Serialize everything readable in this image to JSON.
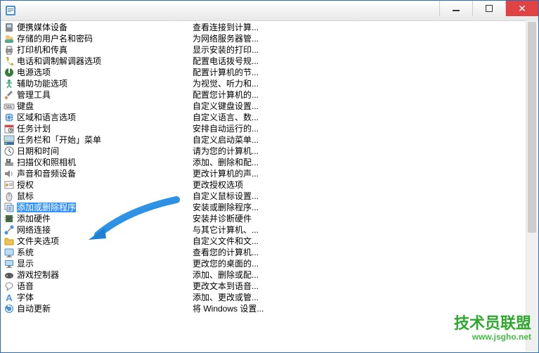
{
  "window": {
    "title": ""
  },
  "items": [
    {
      "icon": "device-icon",
      "name": "便携媒体设备",
      "desc": "查看连接到计算..."
    },
    {
      "icon": "users-icon",
      "name": "存储的用户名和密码",
      "desc": "为网络服务器管..."
    },
    {
      "icon": "printer-icon",
      "name": "打印机和传真",
      "desc": "显示安装的打印..."
    },
    {
      "icon": "phone-icon",
      "name": "电话和调制解调器选项",
      "desc": "配置电话拨号规..."
    },
    {
      "icon": "power-icon",
      "name": "电源选项",
      "desc": "配置计算机的节..."
    },
    {
      "icon": "accessibility-icon",
      "name": "辅助功能选项",
      "desc": "为视觉、听力和..."
    },
    {
      "icon": "tools-icon",
      "name": "管理工具",
      "desc": "配置您计算机的..."
    },
    {
      "icon": "keyboard-icon",
      "name": "键盘",
      "desc": "自定义键盘设置..."
    },
    {
      "icon": "globe-icon",
      "name": "区域和语言选项",
      "desc": "自定义语言、数..."
    },
    {
      "icon": "schedule-icon",
      "name": "任务计划",
      "desc": "安排自动运行的..."
    },
    {
      "icon": "taskbar-icon",
      "name": "任务栏和「开始」菜单",
      "desc": "自定义启动菜单..."
    },
    {
      "icon": "clock-icon",
      "name": "日期和时间",
      "desc": "请为您的计算机..."
    },
    {
      "icon": "scanner-icon",
      "name": "扫描仪和照相机",
      "desc": "添加、删除和配..."
    },
    {
      "icon": "sound-icon",
      "name": "声音和音频设备",
      "desc": "更改计算机的声..."
    },
    {
      "icon": "license-icon",
      "name": "授权",
      "desc": "更改授权选项"
    },
    {
      "icon": "mouse-icon",
      "name": "鼠标",
      "desc": "自定义鼠标设置..."
    },
    {
      "icon": "add-remove-programs-icon",
      "name": "添加或删除程序",
      "desc": "安装或删除程序...",
      "selected": true
    },
    {
      "icon": "hardware-icon",
      "name": "添加硬件",
      "desc": "安装并诊断硬件"
    },
    {
      "icon": "network-icon",
      "name": "网络连接",
      "desc": "与其它计算机、..."
    },
    {
      "icon": "folder-icon",
      "name": "文件夹选项",
      "desc": "自定义文件和文..."
    },
    {
      "icon": "system-icon",
      "name": "系统",
      "desc": "查看您的计算机..."
    },
    {
      "icon": "display-icon",
      "name": "显示",
      "desc": "更改您的桌面的..."
    },
    {
      "icon": "game-icon",
      "name": "游戏控制器",
      "desc": "添加、删除或配..."
    },
    {
      "icon": "speech-icon",
      "name": "语音",
      "desc": "更改文本到语音..."
    },
    {
      "icon": "font-icon",
      "name": "字体",
      "desc": "添加、更改或管..."
    },
    {
      "icon": "update-icon",
      "name": "自动更新",
      "desc": "将 Windows 设置..."
    }
  ],
  "watermark": {
    "text": "技术员联盟",
    "url": "www.jsgho.net"
  }
}
